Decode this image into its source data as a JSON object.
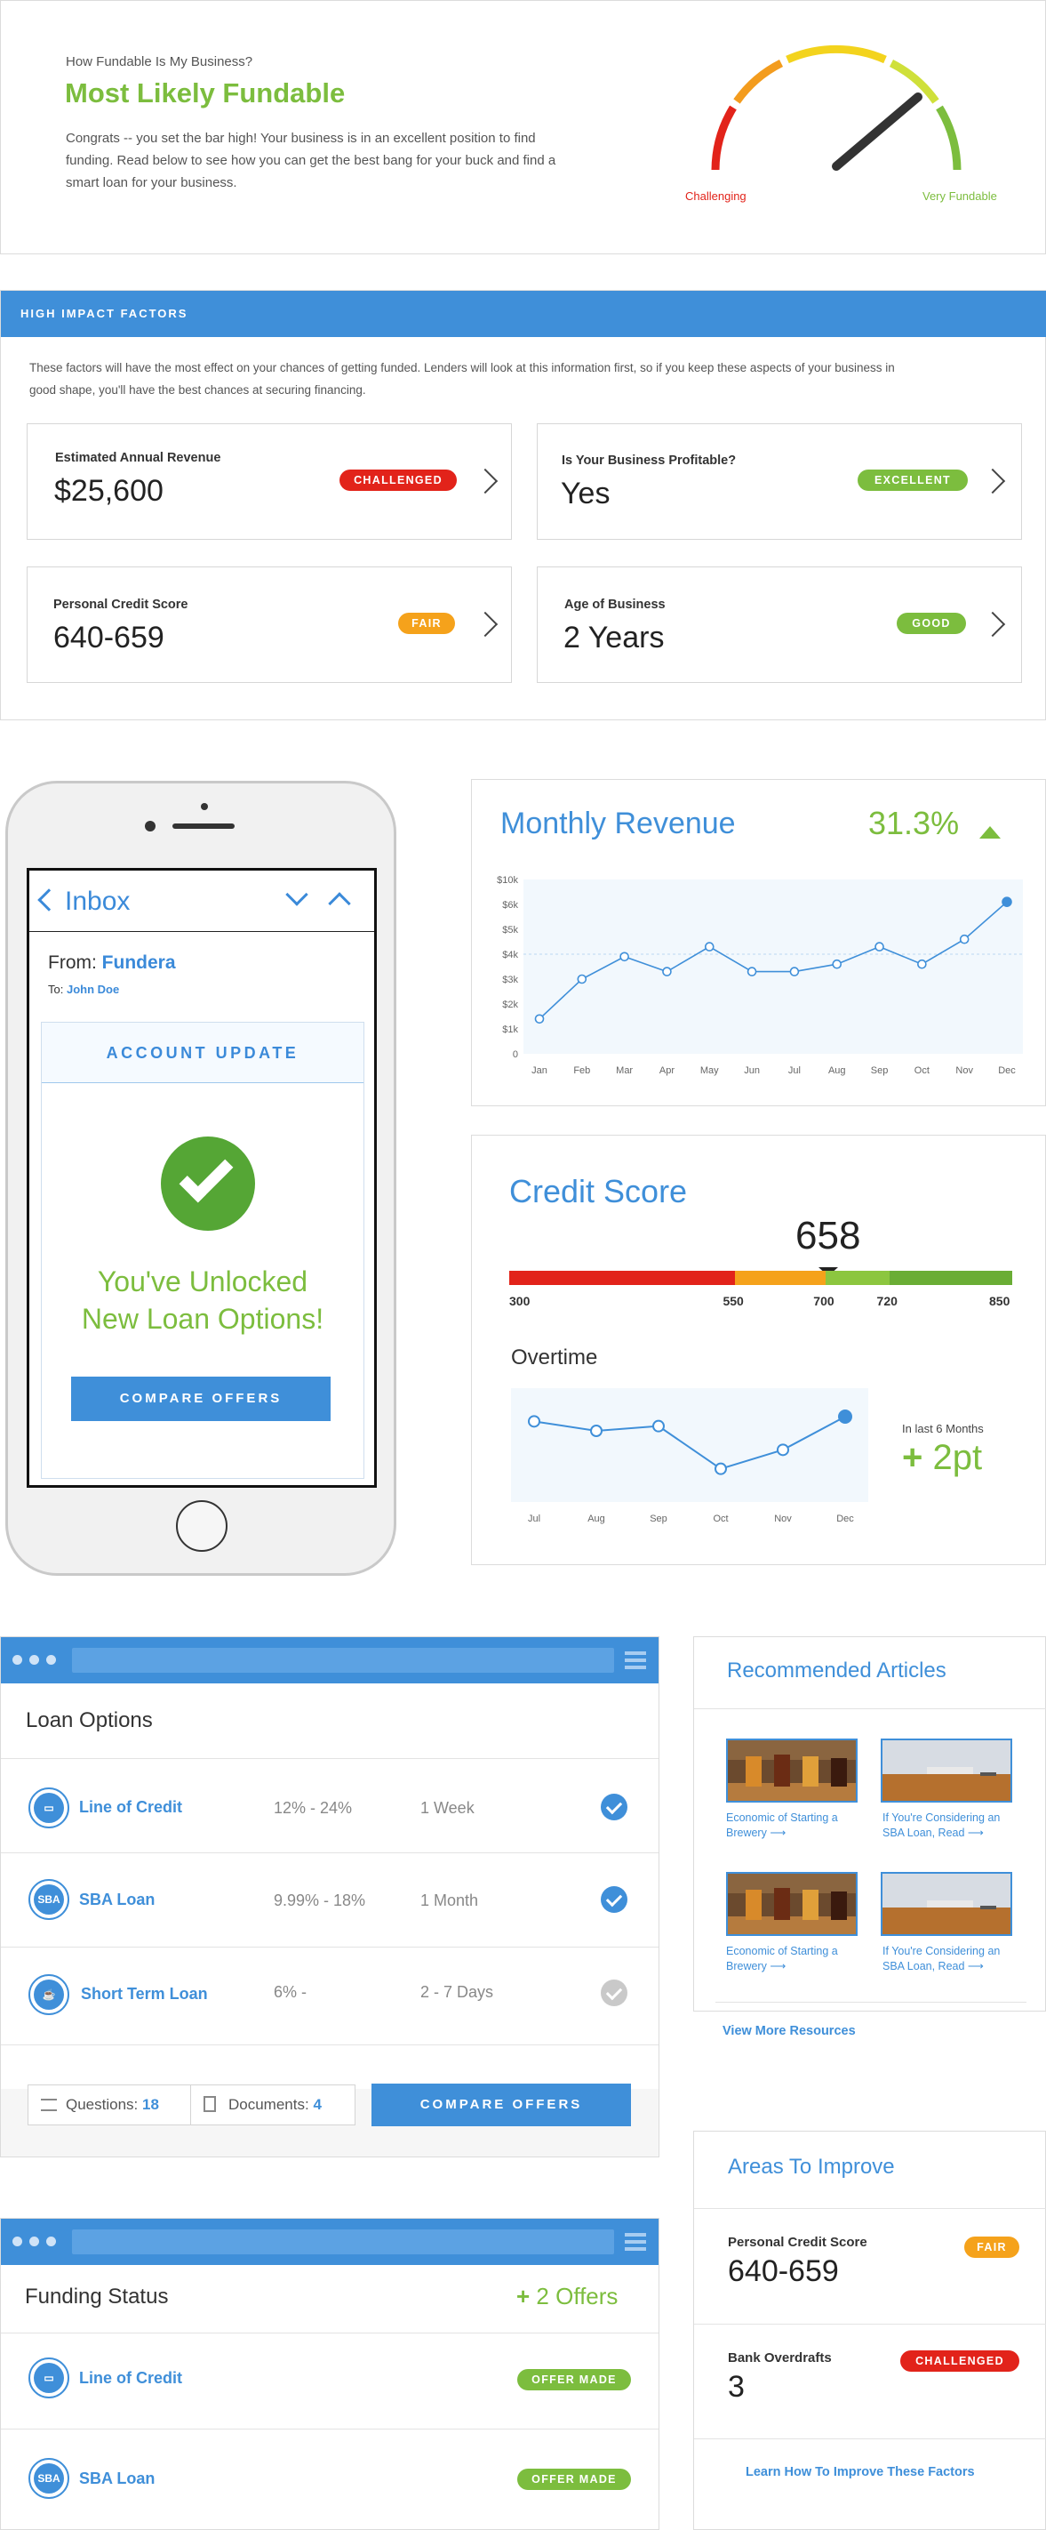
{
  "hero": {
    "question": "How Fundable Is My Business?",
    "title": "Most Likely Fundable",
    "text": "Congrats -- you set the bar high! Your business is in an excellent position to find funding. Read below to see how you can get the best bang for your buck and find a smart loan for your business.",
    "gauge": {
      "low_label": "Challenging",
      "high_label": "Very Fundable",
      "level": 0.8,
      "colors": [
        "#e2231a",
        "#f39c1e",
        "#f3d31d",
        "#cfe03a",
        "#7cbd3e"
      ]
    }
  },
  "high_impact": {
    "header": "HIGH IMPACT FACTORS",
    "intro_line1": "These factors will have the most effect on your chances of getting funded. Lenders will look at this information first, so if you keep these aspects of your business in",
    "intro_line2": "good shape, you'll have the best chances at securing financing.",
    "factors": [
      {
        "title": "Estimated Annual Revenue",
        "value": "$25,600",
        "badge": "CHALLENGED",
        "badge_color": "#e2231a"
      },
      {
        "title": "Is Your Business Profitable?",
        "value": "Yes",
        "badge": "EXCELLENT",
        "badge_color": "#7cbd3e"
      },
      {
        "title": "Personal Credit Score",
        "value": "640-659",
        "badge": "FAIR",
        "badge_color": "#f5a21b"
      },
      {
        "title": "Age of Business",
        "value": "2 Years",
        "badge": "GOOD",
        "badge_color": "#7cbd3e"
      }
    ]
  },
  "phone": {
    "inbox": "Inbox",
    "from_label": "From:",
    "from_value": "Fundera",
    "to_label": "To:",
    "to_value": "John Doe",
    "account_update": "ACCOUNT UPDATE",
    "unlock_line1": "You've Unlocked",
    "unlock_line2": "New Loan Options!",
    "button": "COMPARE OFFERS"
  },
  "revenue": {
    "title": "Monthly Revenue",
    "change": "31.3%",
    "chart_data": {
      "type": "line",
      "categories": [
        "Jan",
        "Feb",
        "Mar",
        "Apr",
        "May",
        "Jun",
        "Jul",
        "Aug",
        "Sep",
        "Oct",
        "Nov",
        "Dec"
      ],
      "values": [
        1.4,
        3.0,
        3.9,
        3.3,
        4.3,
        3.3,
        3.3,
        3.6,
        4.3,
        3.6,
        4.6,
        6.1
      ],
      "y_ticks": [
        "0",
        "$1k",
        "$2k",
        "$3k",
        "$4k",
        "$5k",
        "$6k",
        "$10k"
      ],
      "ylabel": "",
      "xlabel": ""
    }
  },
  "credit": {
    "title": "Credit Score",
    "score": "658",
    "scale": [
      {
        "label": "300",
        "from": 300,
        "to": 550,
        "color": "#e2231a"
      },
      {
        "label": "550",
        "from": 550,
        "to": 700,
        "color": "#f5a21b"
      },
      {
        "label": "700",
        "from": 700,
        "to": 720,
        "color": "#8cc63f"
      },
      {
        "label": "720",
        "from": 720,
        "to": 850,
        "color": "#6aad35"
      },
      {
        "label": "850"
      }
    ],
    "overtime_title": "Overtime",
    "last6_label": "In last 6 Months",
    "change": "2pt",
    "chart_data": {
      "type": "line",
      "categories": [
        "Jul",
        "Aug",
        "Sep",
        "Oct",
        "Nov",
        "Dec"
      ],
      "values": [
        657,
        655,
        656,
        647,
        651,
        658
      ]
    }
  },
  "loan_options": {
    "title": "Loan Options",
    "rows": [
      {
        "icon": "line-of-credit-icon",
        "icon_text": "",
        "name": "Line of Credit",
        "rate": "12% - 24%",
        "time": "1 Week",
        "checked": true
      },
      {
        "icon": "sba-icon",
        "icon_text": "SBA",
        "name": "SBA Loan",
        "rate": "9.99% - 18%",
        "time": "1 Month",
        "checked": true
      },
      {
        "icon": "short-term-loan-icon",
        "icon_text": "",
        "name": "Short Term Loan",
        "rate": "6% -",
        "time": "2 - 7 Days",
        "checked": false
      }
    ],
    "questions_label": "Questions:",
    "questions_count": "18",
    "documents_label": "Documents:",
    "documents_count": "4",
    "button": "COMPARE OFFERS"
  },
  "articles": {
    "title": "Recommended Articles",
    "items": [
      {
        "line1": "Economic of Starting a",
        "line2": "Brewery",
        "image": "beer-flight"
      },
      {
        "line1": "If You're Considering an",
        "line2": "SBA Loan, Read",
        "image": "desk-laptop"
      },
      {
        "line1": "Economic of Starting a",
        "line2": "Brewery",
        "image": "beer-flight"
      },
      {
        "line1": "If You're Considering an",
        "line2": "SBA Loan, Read",
        "image": "desk-laptop"
      }
    ],
    "more": "View More Resources"
  },
  "improve": {
    "title": "Areas To Improve",
    "items": [
      {
        "title": "Personal Credit Score",
        "value": "640-659",
        "badge": "FAIR",
        "badge_color": "#f5a21b"
      },
      {
        "title": "Bank Overdrafts",
        "value": "3",
        "badge": "CHALLENGED",
        "badge_color": "#e2231a"
      }
    ],
    "link": "Learn How To Improve These Factors"
  },
  "funding": {
    "title": "Funding Status",
    "offers": "2 Offers",
    "rows": [
      {
        "name": "Line of Credit",
        "icon_text": "",
        "badge": "OFFER MADE"
      },
      {
        "name": "SBA Loan",
        "icon_text": "SBA",
        "badge": "OFFER MADE"
      }
    ]
  }
}
